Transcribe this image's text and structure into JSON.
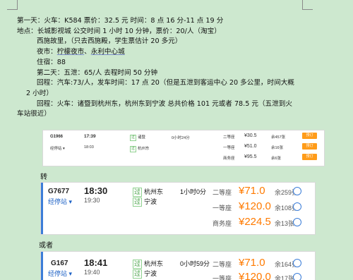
{
  "lines": [
    "第一天：火车：K584 票价：32.5 元 时间：8 点 16 分-11 点 19 分",
    "地点：长城影视城 公交时间 1 小时 10 分钟，票价：20/人（淘宝）",
    "西施故里，（只去西施殿，学生票估计 20 多元）",
    "住宿：88",
    "第二天：五泄：65/人 去程时间 50 分钟",
    "回程：汽车:73/人，发车时间：17 点 20（但是五泄到客运中心 20 多公里，时间大概",
    "2 小时）",
    "回程：火车：诸暨到杭州东，杭州东到宁波 总共价格 101 元或者 78.5 元（五泄到火",
    "车站很近）"
  ],
  "night_market": {
    "prefix": "夜市：",
    "place1": "柠檬夜市",
    "sep": "、",
    "place2": "永利中心城"
  },
  "connector_1": "转",
  "connector_2": "或者",
  "train_g1966": {
    "number": "G1966",
    "stops_link": "经停站",
    "depart_time": "17:39",
    "arrive_time": "18:03",
    "from_tag": "过",
    "from_station": "诸暨",
    "to_tag": "过",
    "to_station": "杭州东",
    "duration": "0小时24分",
    "seats": [
      {
        "class": "二等座",
        "price": "¥30.5",
        "remain": "余457张",
        "button": "预订"
      },
      {
        "class": "一等座",
        "price": "¥51.0",
        "remain": "余16张",
        "button": "预订"
      },
      {
        "class": "商务座",
        "price": "¥95.5",
        "remain": "余6张",
        "button": "预订"
      }
    ]
  },
  "train_g7677": {
    "number": "G7677",
    "stops_link": "经停站",
    "depart_time": "18:30",
    "arrive_time": "19:30",
    "from_tag": "过",
    "from_station": "杭州东",
    "to_tag": "过",
    "to_station": "宁波",
    "duration": "1小时0分",
    "seats": [
      {
        "class": "二等座",
        "price": "¥71.0",
        "remain": "余259张"
      },
      {
        "class": "一等座",
        "price": "¥120.0",
        "remain": "余108张"
      },
      {
        "class": "商务座",
        "price": "¥224.5",
        "remain": "余13张"
      }
    ]
  },
  "train_g167": {
    "number": "G167",
    "stops_link": "经停站",
    "depart_time": "18:41",
    "arrive_time": "19:40",
    "from_tag": "过",
    "from_station": "杭州东",
    "to_tag": "过",
    "to_station": "宁波",
    "duration": "0小时59分",
    "seats": [
      {
        "class": "二等座",
        "price": "¥71.0",
        "remain": "余164张"
      },
      {
        "class": "一等座",
        "price": "¥120.0",
        "remain": "余17张"
      }
    ]
  },
  "colors": {
    "background": "#cde8cf",
    "price": "#ff7a00",
    "link": "#1e62c6",
    "tag": "#3a9a3a",
    "button": "#ff9c1a"
  }
}
